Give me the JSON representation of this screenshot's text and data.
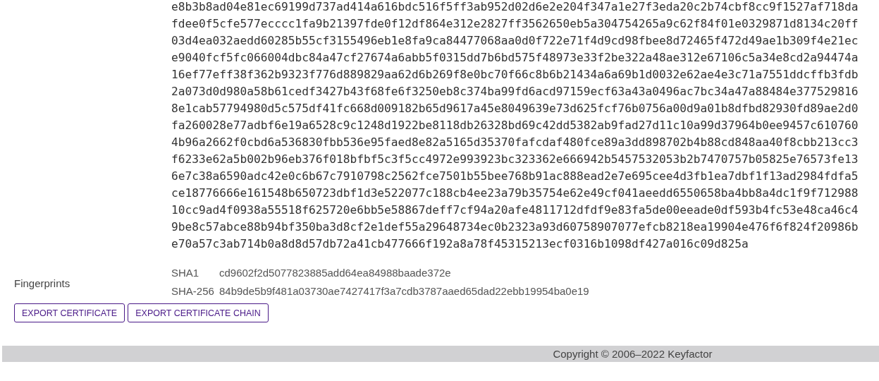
{
  "certificate": {
    "hex_lines": [
      "e8b3b8ad04e81ec69199d737ad414a616bdc516f5ff3ab952d02d6e2e204f347a1e27f3eda20c2b74cbf8cc9f1527af718da",
      "fdee0f5cfe577ecccc1fa9b21397fde0f12df864e312e2827ff3562650eb5a304754265a9c62f84f01e0329871d8134c20ff",
      "03d4ea032aedd60285b55cf3155496eb1e8fa9ca84477068aa0d0f722e71f4d9cd98fbee8d72465f472d49ae1b309f4e21ec",
      "e9040fcf5fc066004dbc84a47cf27674a6abb5f0315dd7b6bd575f48973e33f2be322a48ae312e67106c5a34e8cd2a94474a",
      "16ef77eff38f362b9323f776d889829aa62d6b269f8e0bc70f66c8b6b21434a6a69b1d0032e62ae4e3c71a7551ddcffb3fdb",
      "2a073d0d980a58b61cedf3427b43f68fe6f3250eb8c374ba99fd6acd97159ecf63a43a0496ac7bc34a47a88484e377529816",
      "8e1cab57794980d5c575df41fc668d009182b65d9617a45e8049639e73d625fcf76b0756a00d9a01b8dfbd82930fd89ae2d0",
      "fa260028e77adbf6e19a6528c9c1248d1922be8118db26328bd69c42dd5382ab9fad27d11c10a99d37964b0ee9457c610760",
      "4b96a2662f0cbd6a536830fbb536e95faed8e82a5165d35370fafcdaf480fce89a3dd898702b4b88cd848aa40f8cbb213cc3",
      "f6233e62a5b002b96eb376f018bfbf5c3f5cc4972e993923bc323362e666942b5457532053b2b7470757b05825e76573fe13",
      "6e7c38a6590adc42e0c6b67c7910798c2562fce7501b55bee768b91ac888ead2e7e695cee4d3fb1ea7dbf1f13ad2984fdfa5",
      "ce18776666e161548b650723dbf1d3e522077c188cb4ee23a79b35754e62e49cf041aeedd6550658ba4bb8a4dc1f9f712988",
      "10cc9ad4f0938a55518f625720e6bb5e58867deff7cf94a20afe4811712dfdf9e83fa5de00eeade0df593b4fc53e48ca46c4",
      "9be8c57abce88b94bf350ba3d8cf2e1def55a29648734ec0b2323a93d60758907077efcb8218ea19904e476f6f824f20986b",
      "e70a57c3ab714b0a8d8d57db72a41cb477666f192a8a78f45315213ecf0316b1098df427a016c09d825a"
    ]
  },
  "fingerprints": {
    "label": "Fingerprints",
    "rows": [
      {
        "algorithm": "SHA1",
        "value": "cd9602f2d5077823885add64ea84988baade372e"
      },
      {
        "algorithm": "SHA-256",
        "value": "84b9de5b9f481a03730ae7427417f3a7cdb3787aaed65dad22ebb19954ba0e19"
      }
    ]
  },
  "buttons": [
    "EXPORT CERTIFICATE",
    "EXPORT CERTIFICATE CHAIN"
  ],
  "footer": {
    "copyright": "Copyright © 2006–2022 Keyfactor"
  }
}
